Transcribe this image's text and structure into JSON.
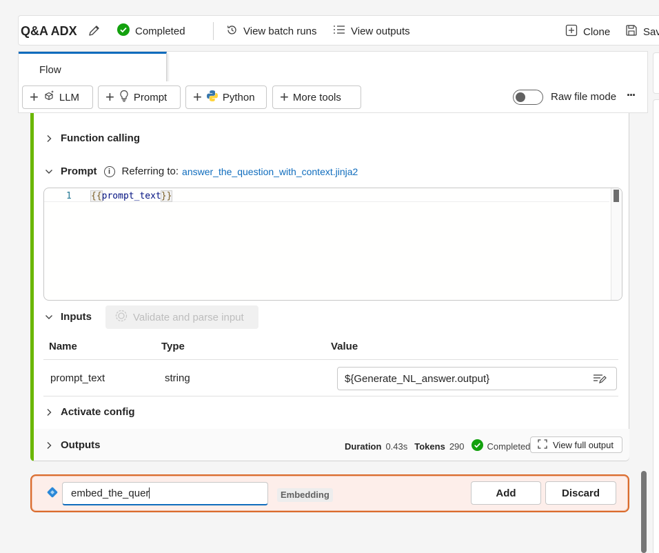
{
  "header": {
    "title": "Q&A ADX",
    "status": "Completed",
    "view_batch_runs": "View batch runs",
    "view_outputs": "View outputs",
    "clone": "Clone",
    "save": "Sav"
  },
  "tabs": [
    {
      "label": "Flow"
    }
  ],
  "toolbar": {
    "llm": "LLM",
    "prompt": "Prompt",
    "python": "Python",
    "more_tools": "More tools",
    "raw_file_mode": "Raw file mode",
    "more": "···"
  },
  "node": {
    "function_calling": "Function calling",
    "prompt_label": "Prompt",
    "referring_to": "Referring to:",
    "prompt_file": "answer_the_question_with_context.jinja2",
    "editor": {
      "line_number": "1",
      "open": "{{",
      "variable": "prompt_text",
      "close": "}}"
    },
    "inputs_label": "Inputs",
    "validate_button": "Validate and parse input",
    "table": {
      "headers": {
        "name": "Name",
        "type": "Type",
        "value": "Value"
      },
      "rows": [
        {
          "name": "prompt_text",
          "type": "string",
          "value": "${Generate_NL_answer.output}"
        }
      ]
    },
    "activate_config": "Activate config",
    "outputs_label": "Outputs",
    "duration_label": "Duration",
    "duration_value": "0.43s",
    "tokens_label": "Tokens",
    "tokens_value": "290",
    "output_status": "Completed",
    "view_full_output": "View full output"
  },
  "new_node": {
    "name_value": "embed_the_quer",
    "type_badge": "Embedding",
    "add": "Add",
    "discard": "Discard"
  },
  "colors": {
    "accent": "#0f6cbd",
    "success": "#13a10e",
    "node_bar": "#6bb700",
    "new_node_border": "#da6b2c"
  }
}
